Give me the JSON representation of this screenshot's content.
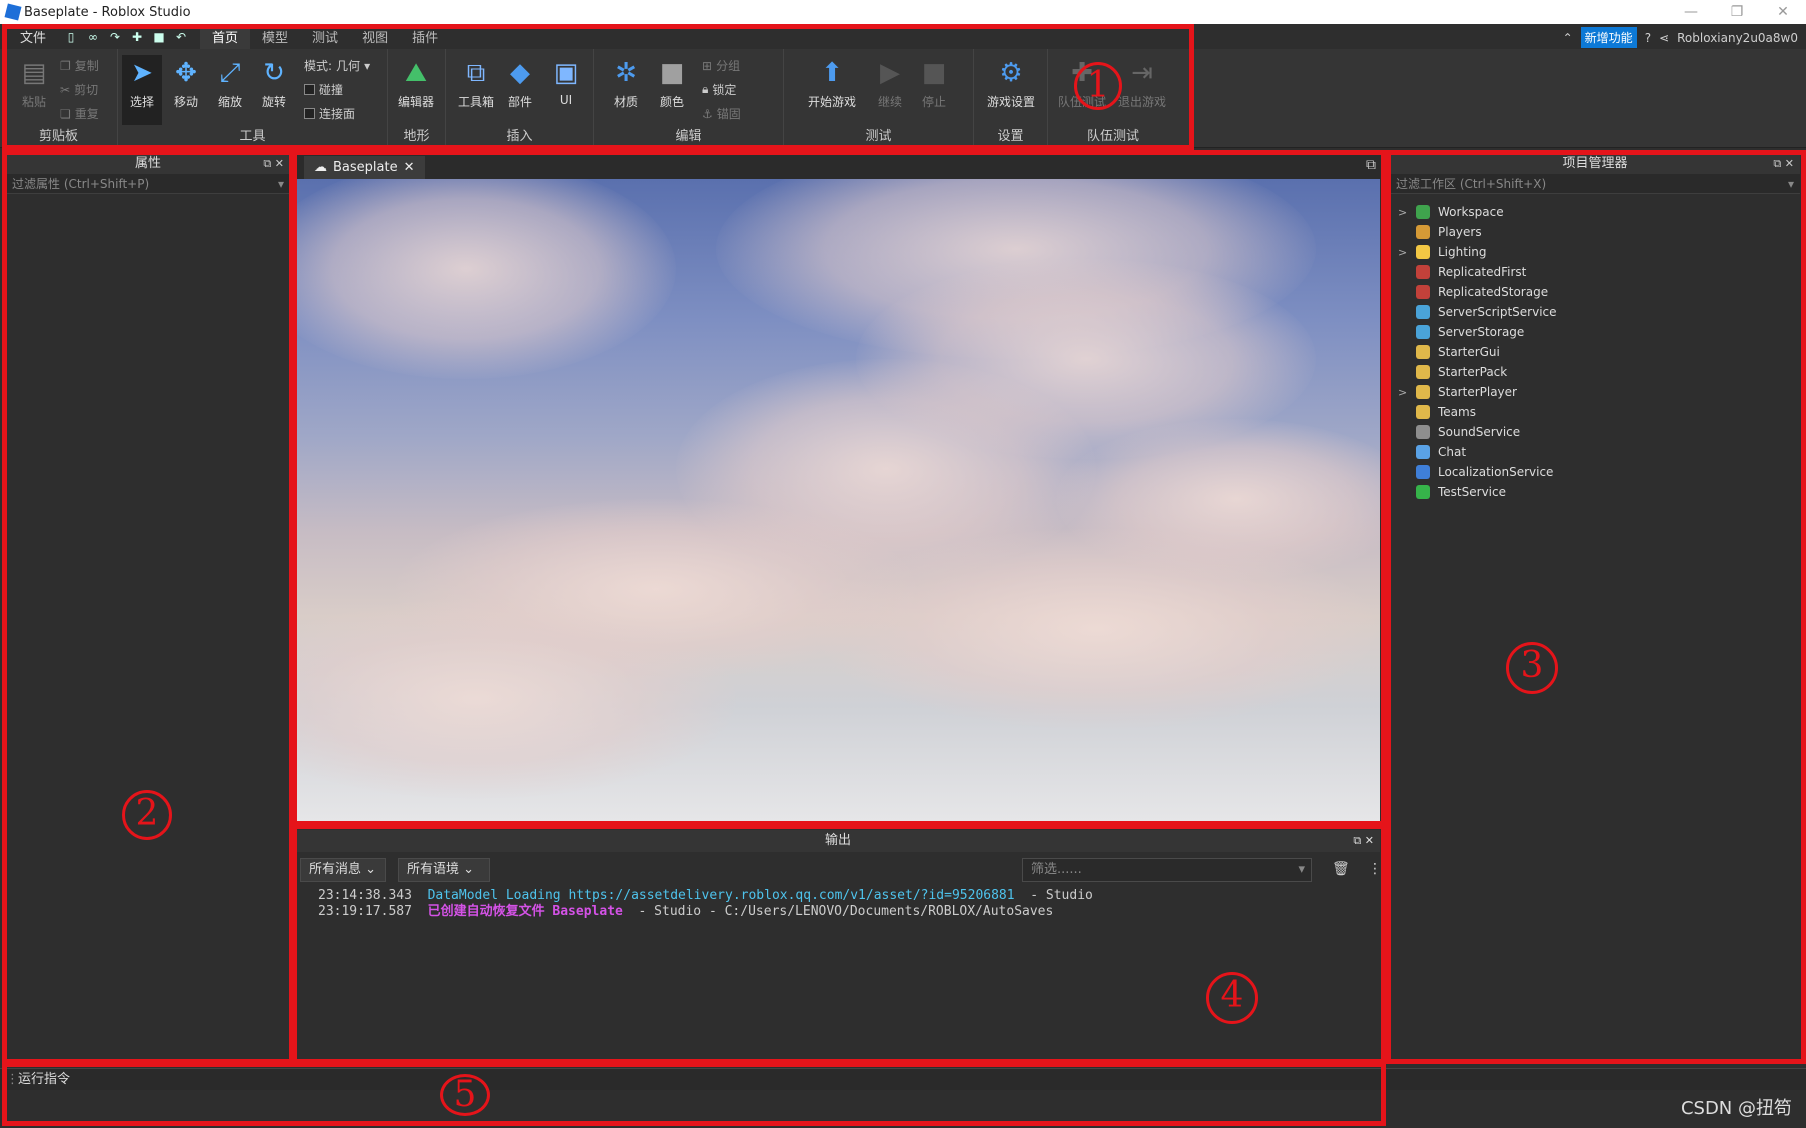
{
  "window": {
    "title": "Baseplate - Roblox Studio",
    "controls": [
      "—",
      "❐",
      "✕"
    ]
  },
  "menu": {
    "file": "文件",
    "tabs": [
      "首页",
      "模型",
      "测试",
      "视图",
      "插件"
    ],
    "new_features": "新增功能",
    "user": "Robloxiany2u0a8w0"
  },
  "ribbon": {
    "clipboard": {
      "paste": "粘贴",
      "copy": "复制",
      "cut": "剪切",
      "duplicate": "重复",
      "label": "剪贴板"
    },
    "tools": {
      "select": "选择",
      "move": "移动",
      "scale": "缩放",
      "rotate": "旋转",
      "mode_label": "模式:",
      "mode_value": "几何",
      "collision": "碰撞",
      "join": "连接面",
      "label": "工具"
    },
    "terrain": {
      "editor": "编辑器",
      "label": "地形"
    },
    "insert": {
      "toolbox": "工具箱",
      "part": "部件",
      "ui": "UI",
      "label": "插入"
    },
    "edit": {
      "material": "材质",
      "color": "颜色",
      "group": "分组",
      "lock": "锁定",
      "anchor": "锚固",
      "label": "编辑"
    },
    "test": {
      "play": "开始游戏",
      "resume": "继续",
      "stop": "停止",
      "label": "测试"
    },
    "settings": {
      "game_settings": "游戏设置",
      "label": "设置"
    },
    "team_test": {
      "team_test": "队伍测试",
      "exit": "退出游戏",
      "label": "队伍测试"
    }
  },
  "properties": {
    "title": "属性",
    "filter": "过滤属性 (Ctrl+Shift+P)"
  },
  "viewport": {
    "tab": "Baseplate"
  },
  "output": {
    "title": "输出",
    "all_messages": "所有消息",
    "all_contexts": "所有语境",
    "filter_placeholder": "筛选......",
    "lines": [
      {
        "time": "23:14:38.343",
        "msg": "DataModel Loading https://assetdelivery.roblox.qq.com/v1/asset/?id=95206881",
        "suffix": "- Studio"
      },
      {
        "time": "23:19:17.587",
        "msg": "已创建自动恢复文件 Baseplate",
        "suffix": "- Studio - C:/Users/LENOVO/Documents/ROBLOX/AutoSaves"
      }
    ]
  },
  "explorer": {
    "title": "项目管理器",
    "filter": "过滤工作区 (Ctrl+Shift+X)",
    "items": [
      {
        "name": "Workspace",
        "expand": ">",
        "color": "#3fa34d"
      },
      {
        "name": "Players",
        "expand": "",
        "color": "#d59a36"
      },
      {
        "name": "Lighting",
        "expand": ">",
        "color": "#f2c744"
      },
      {
        "name": "ReplicatedFirst",
        "expand": "",
        "color": "#c2413a"
      },
      {
        "name": "ReplicatedStorage",
        "expand": "",
        "color": "#c2413a"
      },
      {
        "name": "ServerScriptService",
        "expand": "",
        "color": "#4aa3d8"
      },
      {
        "name": "ServerStorage",
        "expand": "",
        "color": "#4aa3d8"
      },
      {
        "name": "StarterGui",
        "expand": "",
        "color": "#e0b84a"
      },
      {
        "name": "StarterPack",
        "expand": "",
        "color": "#e0b84a"
      },
      {
        "name": "StarterPlayer",
        "expand": ">",
        "color": "#e0b84a"
      },
      {
        "name": "Teams",
        "expand": "",
        "color": "#e0b84a"
      },
      {
        "name": "SoundService",
        "expand": "",
        "color": "#8e8e8e"
      },
      {
        "name": "Chat",
        "expand": "",
        "color": "#5aa2e6"
      },
      {
        "name": "LocalizationService",
        "expand": "",
        "color": "#3f7fd8"
      },
      {
        "name": "TestService",
        "expand": "",
        "color": "#36b34a"
      }
    ]
  },
  "command": {
    "label": "运行指令"
  },
  "annotations": {
    "n1": "1",
    "n2": "2",
    "n3": "3",
    "n4": "4",
    "n5": "5"
  },
  "watermark": "CSDN @扭笱"
}
